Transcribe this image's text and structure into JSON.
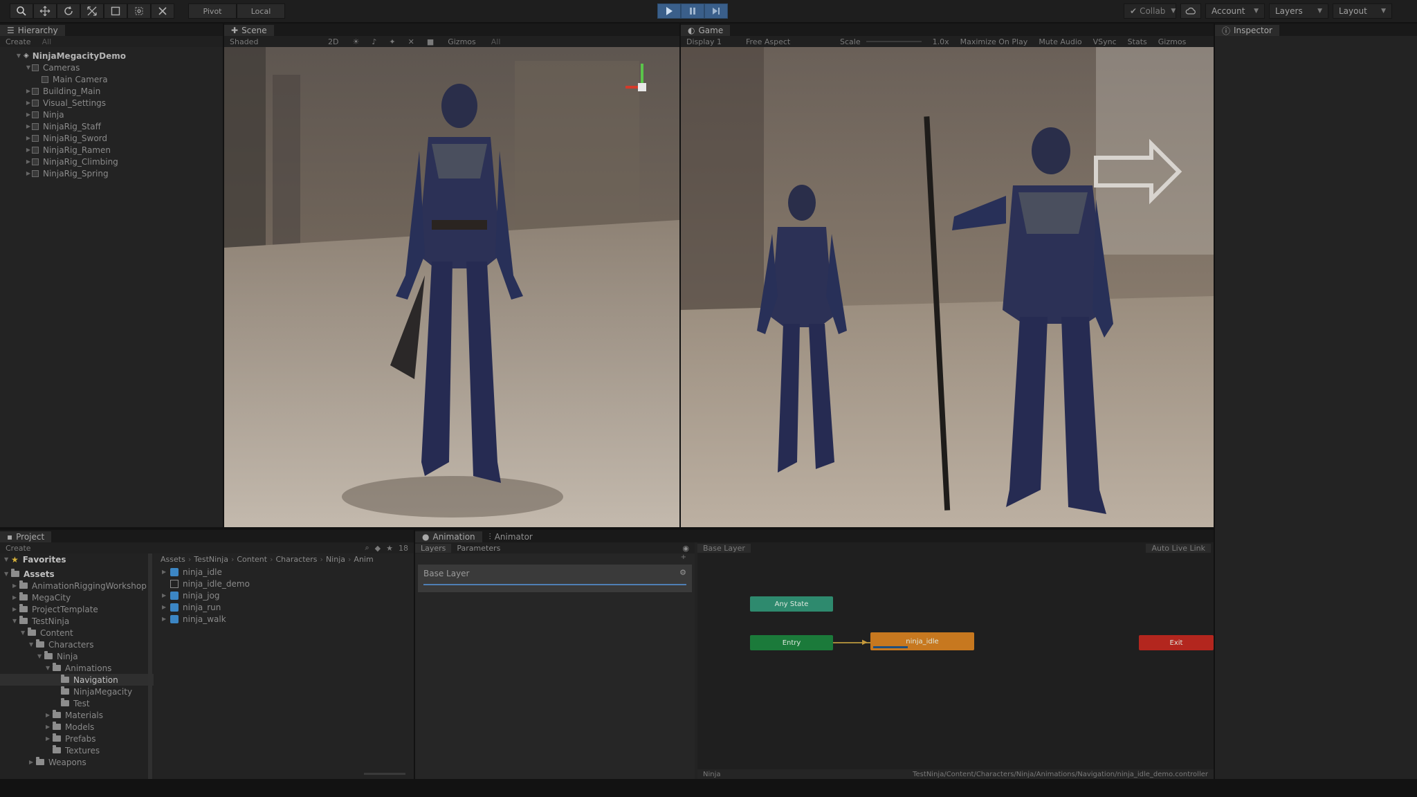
{
  "toolbar": {
    "tools": [
      "hand-tool",
      "move-tool",
      "rotate-tool",
      "scale-tool",
      "rect-tool",
      "transform-tool",
      "custom-tool"
    ],
    "pivot": "Pivot",
    "local": "Local",
    "collab": "Collab",
    "account": "Account",
    "layers": "Layers",
    "layout": "Layout"
  },
  "hierarchy": {
    "tab": "Hierarchy",
    "create": "Create",
    "search": "All",
    "scene": "NinjaMegacityDemo",
    "items": [
      {
        "label": "Cameras",
        "depth": 1,
        "arrow": "▼"
      },
      {
        "label": "Main Camera",
        "depth": 2,
        "arrow": ""
      },
      {
        "label": "Building_Main",
        "depth": 1,
        "arrow": "▶"
      },
      {
        "label": "Visual_Settings",
        "depth": 1,
        "arrow": "▶"
      },
      {
        "label": "Ninja",
        "depth": 1,
        "arrow": "▶"
      },
      {
        "label": "NinjaRig_Staff",
        "depth": 1,
        "arrow": "▶"
      },
      {
        "label": "NinjaRig_Sword",
        "depth": 1,
        "arrow": "▶"
      },
      {
        "label": "NinjaRig_Ramen",
        "depth": 1,
        "arrow": "▶"
      },
      {
        "label": "NinjaRig_Climbing",
        "depth": 1,
        "arrow": "▶"
      },
      {
        "label": "NinjaRig_Spring",
        "depth": 1,
        "arrow": "▶"
      }
    ]
  },
  "scene": {
    "tab": "Scene",
    "shading": "Shaded",
    "mode": "2D",
    "gizmos": "Gizmos",
    "search": "All"
  },
  "game": {
    "tab": "Game",
    "display": "Display 1",
    "aspect": "Free Aspect",
    "scale": "Scale",
    "scale_value": "1.0x",
    "options": [
      "Maximize On Play",
      "Mute Audio",
      "VSync",
      "Stats",
      "Gizmos"
    ]
  },
  "inspector": {
    "tab": "Inspector"
  },
  "project": {
    "tab": "Project",
    "create": "Create",
    "count": "18",
    "favorites": "Favorites",
    "assets": "Assets",
    "tree": [
      {
        "label": "AnimationRiggingWorkshop",
        "depth": 1,
        "arrow": "▶"
      },
      {
        "label": "MegaCity",
        "depth": 1,
        "arrow": "▶"
      },
      {
        "label": "ProjectTemplate",
        "depth": 1,
        "arrow": "▶"
      },
      {
        "label": "TestNinja",
        "depth": 1,
        "arrow": "▼"
      },
      {
        "label": "Content",
        "depth": 2,
        "arrow": "▼"
      },
      {
        "label": "Characters",
        "depth": 3,
        "arrow": "▼"
      },
      {
        "label": "Ninja",
        "depth": 4,
        "arrow": "▼"
      },
      {
        "label": "Animations",
        "depth": 5,
        "arrow": "▼"
      },
      {
        "label": "Navigation",
        "depth": 6,
        "arrow": "",
        "selected": true
      },
      {
        "label": "NinjaMegacity",
        "depth": 6,
        "arrow": ""
      },
      {
        "label": "Test",
        "depth": 6,
        "arrow": ""
      },
      {
        "label": "Materials",
        "depth": 5,
        "arrow": "▶"
      },
      {
        "label": "Models",
        "depth": 5,
        "arrow": "▶"
      },
      {
        "label": "Prefabs",
        "depth": 5,
        "arrow": "▶"
      },
      {
        "label": "Textures",
        "depth": 5,
        "arrow": ""
      },
      {
        "label": "Weapons",
        "depth": 3,
        "arrow": "▶"
      }
    ],
    "breadcrumb": [
      "Assets",
      "TestNinja",
      "Content",
      "Characters",
      "Ninja",
      "Anim"
    ],
    "files": [
      {
        "label": "ninja_idle",
        "kind": "anim"
      },
      {
        "label": "ninja_idle_demo",
        "kind": "controller"
      },
      {
        "label": "ninja_jog",
        "kind": "anim"
      },
      {
        "label": "ninja_run",
        "kind": "anim"
      },
      {
        "label": "ninja_walk",
        "kind": "anim"
      }
    ]
  },
  "animation": {
    "tab_animation": "Animation",
    "tab_animator": "Animator",
    "layers_tab": "Layers",
    "parameters_tab": "Parameters",
    "layer": "Base Layer",
    "crumb": "Base Layer",
    "auto_live_link": "Auto Live Link",
    "nodes": {
      "any_state": "Any State",
      "entry": "Entry",
      "default_state": "ninja_idle",
      "exit": "Exit"
    },
    "default_state_progress": 0.35,
    "footer_left": "Ninja",
    "footer_path": "TestNinja/Content/Characters/Ninja/Animations/Navigation/ninja_idle_demo.controller"
  },
  "colors": {
    "any_state": "#2e8a6e",
    "entry": "#1b7a3a",
    "default_state": "#c7781f",
    "exit": "#b3261e",
    "selection": "#3a5f8a"
  }
}
